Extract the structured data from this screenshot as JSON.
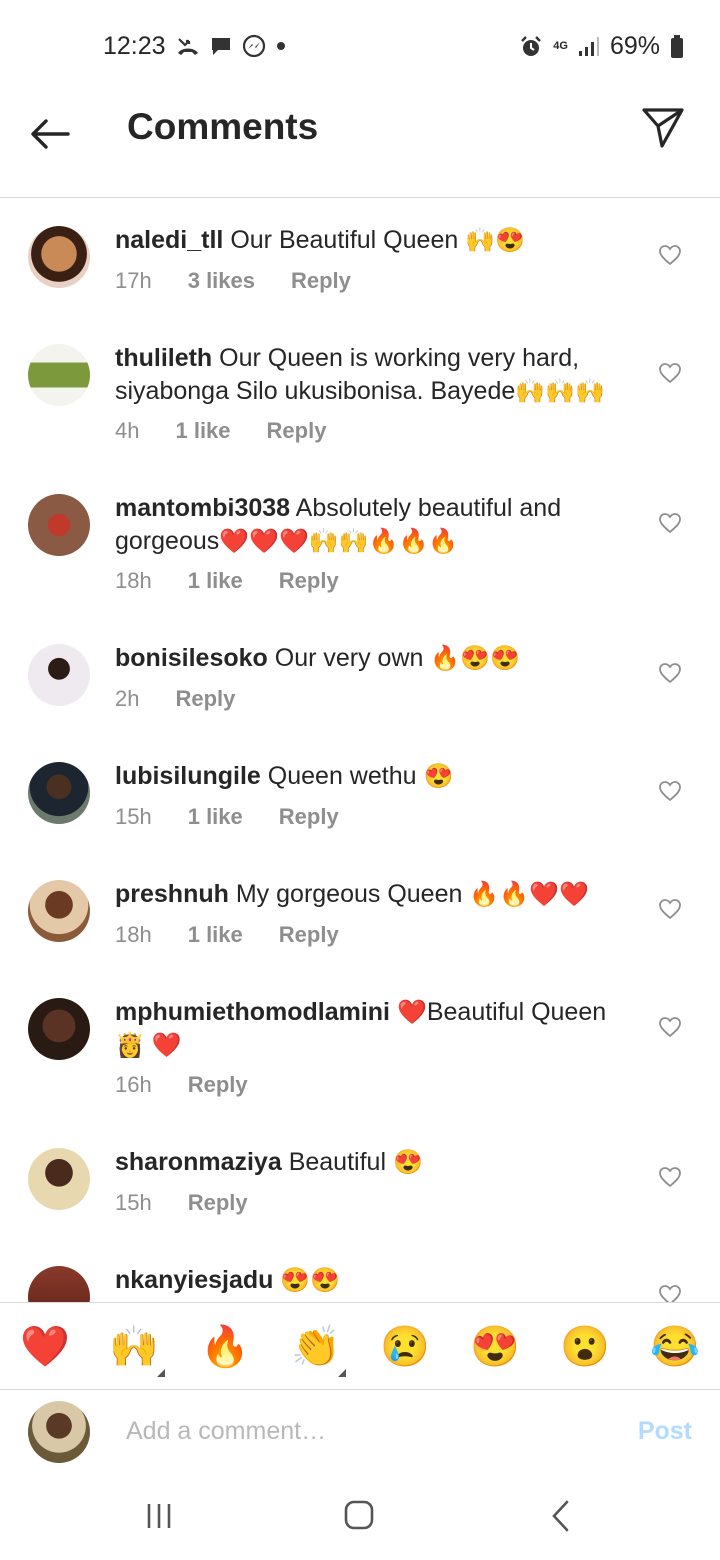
{
  "status_bar": {
    "time": "12:23",
    "battery": "69%",
    "network": "4G",
    "icons": [
      "missed-call-icon",
      "message-icon",
      "messenger-icon",
      "dot-icon",
      "alarm-icon",
      "signal-icon",
      "battery-icon"
    ]
  },
  "header": {
    "title": "Comments",
    "back_icon": "arrow-left-icon",
    "send_icon": "paper-plane-icon"
  },
  "comments": [
    {
      "user": "naledi_tll",
      "text": "Our Beautiful Queen",
      "emoji": "🙌😍",
      "time": "17h",
      "likes": "3 likes",
      "reply": "Reply"
    },
    {
      "user": "thulileth",
      "text": "Our Queen is working very hard, siyabonga Silo ukusibonisa. Bayede",
      "emoji": "🙌🙌🙌",
      "time": "4h",
      "likes": "1 like",
      "reply": "Reply"
    },
    {
      "user": "mantombi3038",
      "text": "Absolutely beautiful and gorgeous",
      "emoji": "❤️❤️❤️🙌🙌🔥🔥🔥",
      "time": "18h",
      "likes": "1 like",
      "reply": "Reply"
    },
    {
      "user": "bonisilesoko",
      "text": "Our very own",
      "emoji": "🔥😍😍",
      "time": "2h",
      "likes": "",
      "reply": "Reply"
    },
    {
      "user": "lubisilungile",
      "text": "Queen wethu",
      "emoji": "😍",
      "time": "15h",
      "likes": "1 like",
      "reply": "Reply"
    },
    {
      "user": "preshnuh",
      "text": "My gorgeous Queen",
      "emoji": "🔥🔥❤️❤️",
      "time": "18h",
      "likes": "1 like",
      "reply": "Reply"
    },
    {
      "user": "mphumiethomodlamini",
      "text": "Beautiful Queen",
      "emoji_pre": "❤️",
      "emoji": "👸 ❤️",
      "time": "16h",
      "likes": "",
      "reply": "Reply"
    },
    {
      "user": "sharonmaziya",
      "text": "Beautiful",
      "emoji": "😍",
      "time": "15h",
      "likes": "",
      "reply": "Reply"
    },
    {
      "user": "nkanyiesjadu",
      "text": "",
      "emoji": "😍😍",
      "time": "",
      "likes": "",
      "reply": ""
    }
  ],
  "reactions": [
    "❤️",
    "🙌",
    "🔥",
    "👏",
    "😢",
    "😍",
    "😮",
    "😂"
  ],
  "input": {
    "placeholder": "Add a comment…",
    "post_label": "Post"
  },
  "nav": {
    "icons": [
      "recent-apps-icon",
      "home-icon",
      "back-icon"
    ]
  }
}
